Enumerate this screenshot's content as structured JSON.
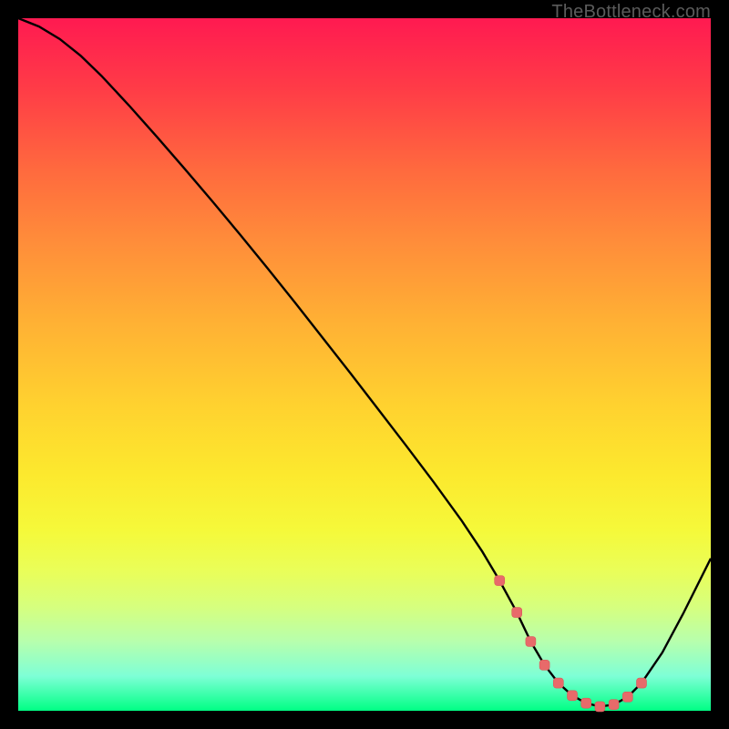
{
  "watermark": "TheBottleneck.com",
  "colors": {
    "curve_stroke": "#000000",
    "marker_fill": "#e86a6a",
    "marker_stroke": "#d85a5a"
  },
  "chart_data": {
    "type": "line",
    "title": "",
    "xlabel": "",
    "ylabel": "",
    "xlim": [
      0,
      100
    ],
    "ylim": [
      0,
      100
    ],
    "grid": false,
    "series": [
      {
        "name": "bottleneck-curve",
        "x": [
          0,
          3,
          6,
          9,
          12,
          16,
          20,
          24,
          28,
          32,
          36,
          40,
          44,
          48,
          52,
          56,
          60,
          64,
          67,
          69.5,
          72,
          74,
          76,
          78,
          80,
          82,
          84,
          86,
          88,
          90,
          93,
          96,
          100
        ],
        "y": [
          100,
          98.8,
          97.0,
          94.6,
          91.7,
          87.4,
          82.9,
          78.3,
          73.6,
          68.8,
          63.9,
          58.9,
          53.8,
          48.7,
          43.5,
          38.3,
          33.0,
          27.5,
          23.0,
          18.8,
          14.2,
          10.0,
          6.6,
          4.0,
          2.2,
          1.1,
          0.6,
          0.9,
          2.0,
          4.0,
          8.4,
          14.0,
          22.0
        ]
      }
    ],
    "markers": {
      "name": "dotted-valley",
      "x": [
        69.5,
        72,
        74,
        76,
        78,
        80,
        82,
        84,
        86,
        88,
        90
      ],
      "y": [
        18.8,
        14.2,
        10.0,
        6.6,
        4.0,
        2.2,
        1.1,
        0.6,
        0.9,
        2.0,
        4.0
      ]
    }
  }
}
